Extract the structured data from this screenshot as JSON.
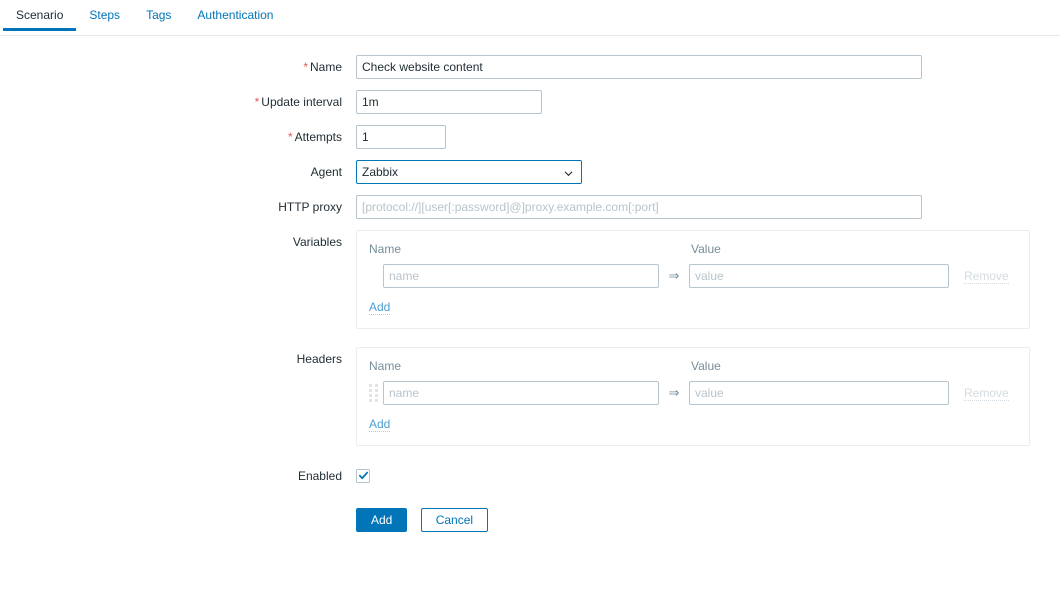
{
  "tabs": [
    {
      "label": "Scenario",
      "active": true
    },
    {
      "label": "Steps",
      "active": false
    },
    {
      "label": "Tags",
      "active": false
    },
    {
      "label": "Authentication",
      "active": false
    }
  ],
  "form": {
    "name": {
      "label": "Name",
      "required_mark": "*",
      "value": "Check website content"
    },
    "update_interval": {
      "label": "Update interval",
      "required_mark": "*",
      "value": "1m"
    },
    "attempts": {
      "label": "Attempts",
      "required_mark": "*",
      "value": "1"
    },
    "agent": {
      "label": "Agent",
      "value": "Zabbix",
      "options": [
        "Zabbix"
      ]
    },
    "http_proxy": {
      "label": "HTTP proxy",
      "value": "",
      "placeholder": "[protocol://][user[:password]@]proxy.example.com[:port]"
    },
    "variables": {
      "label": "Variables",
      "col_name": "Name",
      "col_value": "Value",
      "name_placeholder": "name",
      "name_value": "",
      "value_placeholder": "value",
      "value_value": "",
      "arrow": "⇒",
      "remove_label": "Remove",
      "add_label": "Add"
    },
    "headers": {
      "label": "Headers",
      "col_name": "Name",
      "col_value": "Value",
      "name_placeholder": "name",
      "name_value": "",
      "value_placeholder": "value",
      "value_value": "",
      "arrow": "⇒",
      "remove_label": "Remove",
      "add_label": "Add"
    },
    "enabled": {
      "label": "Enabled",
      "checked": true
    }
  },
  "actions": {
    "submit_label": "Add",
    "cancel_label": "Cancel"
  },
  "colors": {
    "accent": "#0275b8",
    "required": "#e45959",
    "link": "#4c9fd4",
    "muted": "#768d99",
    "border": "#b8c4cb"
  }
}
